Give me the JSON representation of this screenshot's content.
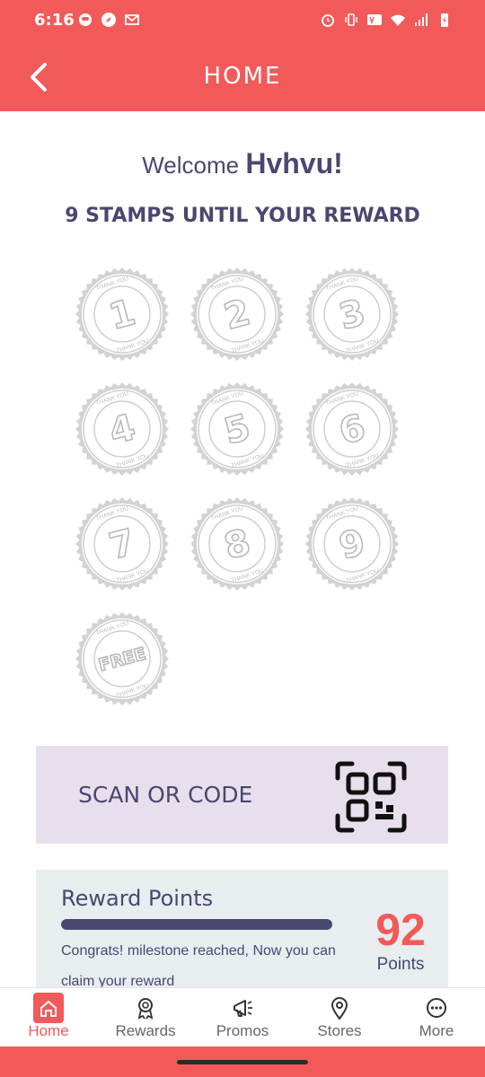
{
  "status": {
    "time": "6:16",
    "icons": [
      "notification-icon",
      "compass-icon",
      "gmail-icon",
      "alarm-icon",
      "vibrate-icon",
      "volte-icon",
      "wifi-icon",
      "signal-icon",
      "battery-icon"
    ]
  },
  "header": {
    "title": "HOME",
    "back_icon": "chevron-left-icon"
  },
  "welcome": {
    "prefix": "Welcome",
    "username": "Hvhvu!"
  },
  "stamps": {
    "message": "9 STAMPS UNTIL YOUR REWARD",
    "ring_text": "THANK YOU",
    "items": [
      "1",
      "2",
      "3",
      "4",
      "5",
      "6",
      "7",
      "8",
      "9",
      "FREE"
    ]
  },
  "scan": {
    "label": "SCAN OR CODE",
    "icon": "qr-code-icon"
  },
  "points": {
    "title": "Reward Points",
    "progress_percent": 100,
    "message": "Congrats! milestone reached, Now you can claim your reward",
    "value": "92",
    "unit": "Points"
  },
  "nav": {
    "items": [
      {
        "label": "Home",
        "icon": "home-icon",
        "active": true
      },
      {
        "label": "Rewards",
        "icon": "award-icon",
        "active": false
      },
      {
        "label": "Promos",
        "icon": "megaphone-icon",
        "active": false
      },
      {
        "label": "Stores",
        "icon": "location-pin-icon",
        "active": false
      },
      {
        "label": "More",
        "icon": "more-icon",
        "active": false
      }
    ]
  },
  "colors": {
    "brand": "#f25a5a",
    "text": "#4a4770",
    "scan_bg": "#e8dfed",
    "points_bg": "#e8edf0",
    "stamp_gray": "#cfcfcf"
  }
}
